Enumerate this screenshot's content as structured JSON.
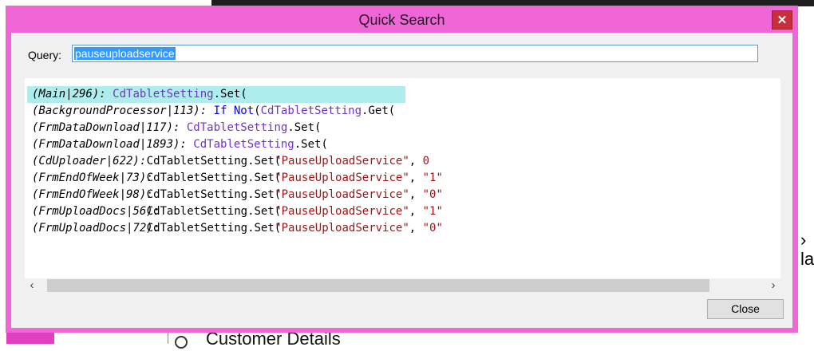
{
  "background": {
    "right_glyph": "›",
    "right_text": "la",
    "bottom_text": "Customer Details"
  },
  "dialog": {
    "title": "Quick Search",
    "close_glyph": "✕"
  },
  "query": {
    "label": "Query:",
    "value": "pauseuploadservice"
  },
  "results": [
    {
      "origin": "(Main|296):",
      "code": [
        [
          "cls",
          "CdTabletSetting"
        ],
        [
          "plain",
          ".Set("
        ]
      ],
      "highlighted": true
    },
    {
      "origin": "(BackgroundProcessor|113):",
      "code": [
        [
          "kw",
          "If"
        ],
        [
          "plain",
          " "
        ],
        [
          "kw",
          "Not"
        ],
        [
          "plain",
          "("
        ],
        [
          "cls",
          "CdTabletSetting"
        ],
        [
          "plain",
          ".Get("
        ]
      ]
    },
    {
      "origin": "(FrmDataDownload|117):",
      "code": [
        [
          "cls",
          "CdTabletSetting"
        ],
        [
          "plain",
          ".Set("
        ]
      ]
    },
    {
      "origin": "(FrmDataDownload|1893):",
      "code": [
        [
          "cls",
          "CdTabletSetting"
        ],
        [
          "plain",
          ".Set("
        ]
      ]
    },
    {
      "origin": "(CdUploader|622):",
      "code": [
        [
          "plain",
          "CdTabletSetting.Set("
        ]
      ],
      "overlay": [
        [
          "str",
          "\"PauseUploadService\""
        ],
        [
          "plain",
          ", "
        ],
        [
          "str",
          "0"
        ]
      ]
    },
    {
      "origin": "(FrmEndOfWeek|73):",
      "code": [
        [
          "plain",
          "CdTabletSetting.Set("
        ]
      ],
      "overlay": [
        [
          "str",
          "\"PauseUploadService\""
        ],
        [
          "plain",
          ", "
        ],
        [
          "str",
          "\"1\""
        ]
      ]
    },
    {
      "origin": "(FrmEndOfWeek|98):",
      "code": [
        [
          "plain",
          "CdTabletSetting.Set("
        ]
      ],
      "overlay": [
        [
          "str",
          "\"PauseUploadService\""
        ],
        [
          "plain",
          ", "
        ],
        [
          "str",
          "\"0\""
        ]
      ]
    },
    {
      "origin": "(FrmUploadDocs|56):",
      "code": [
        [
          "plain",
          "CdTabletSetting.Set("
        ]
      ],
      "overlay": [
        [
          "str",
          "\"PauseUploadService\""
        ],
        [
          "plain",
          ", "
        ],
        [
          "str",
          "\"1\""
        ]
      ]
    },
    {
      "origin": "(FrmUploadDocs|72):",
      "code": [
        [
          "plain",
          "CdTabletSetting.Set("
        ]
      ],
      "overlay": [
        [
          "str",
          "\"PauseUploadService\""
        ],
        [
          "plain",
          ", "
        ],
        [
          "str",
          "\"0\""
        ]
      ]
    }
  ],
  "scrollbar": {
    "left_glyph": "‹",
    "right_glyph": "›"
  },
  "buttons": {
    "close_label": "Close"
  }
}
